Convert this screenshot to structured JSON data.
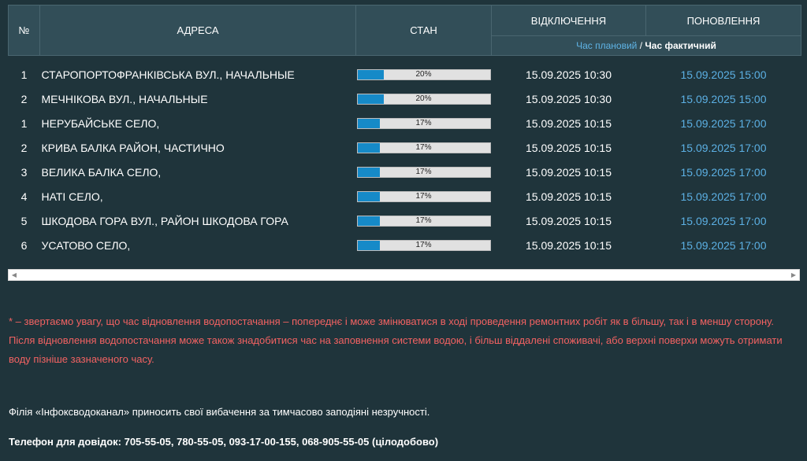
{
  "table": {
    "headers": {
      "num": "№",
      "address": "АДРЕСА",
      "status": "СТАН",
      "outage": "ВІДКЛЮЧЕННЯ",
      "restore": "ПОНОВЛЕННЯ",
      "sub_planned": "Час плановий",
      "sub_sep": " / ",
      "sub_actual": "Час фактичний"
    },
    "rows": [
      {
        "num": "1",
        "address": "СТАРОПОРТОФРАНКІВСЬКА ВУЛ., НАЧАЛЬНЫЕ",
        "progress": 0.2,
        "pct": "20%",
        "off": "15.09.2025 10:30",
        "on": "15.09.2025 15:00"
      },
      {
        "num": "2",
        "address": "МЕЧНІКОВА ВУЛ., НАЧАЛЬНЫЕ",
        "progress": 0.2,
        "pct": "20%",
        "off": "15.09.2025 10:30",
        "on": "15.09.2025 15:00"
      },
      {
        "num": "1",
        "address": "НЕРУБАЙСЬКЕ СЕЛО,",
        "progress": 0.17,
        "pct": "17%",
        "off": "15.09.2025 10:15",
        "on": "15.09.2025 17:00"
      },
      {
        "num": "2",
        "address": "КРИВА БАЛКА РАЙОН, ЧАСТИЧНО",
        "progress": 0.17,
        "pct": "17%",
        "off": "15.09.2025 10:15",
        "on": "15.09.2025 17:00"
      },
      {
        "num": "3",
        "address": "ВЕЛИКА БАЛКА СЕЛО,",
        "progress": 0.17,
        "pct": "17%",
        "off": "15.09.2025 10:15",
        "on": "15.09.2025 17:00"
      },
      {
        "num": "4",
        "address": "НАТІ СЕЛО,",
        "progress": 0.17,
        "pct": "17%",
        "off": "15.09.2025 10:15",
        "on": "15.09.2025 17:00"
      },
      {
        "num": "5",
        "address": "ШКОДОВА ГОРА ВУЛ., РАЙОН ШКОДОВА ГОРА",
        "progress": 0.17,
        "pct": "17%",
        "off": "15.09.2025 10:15",
        "on": "15.09.2025 17:00"
      },
      {
        "num": "6",
        "address": "УСАТОВО СЕЛО,",
        "progress": 0.17,
        "pct": "17%",
        "off": "15.09.2025 10:15",
        "on": "15.09.2025 17:00"
      }
    ]
  },
  "scrollbar": {
    "left_arrow": "◀",
    "right_arrow": "▶"
  },
  "note": "* – звертаємо увагу, що час відновлення водопостачання – попереднє і може змінюватися в ході проведення ремонтних робіт як в більшу, так і в меншу сторону. Після відновлення водопостачання може також знадобитися час на заповнення системи водою, і більш віддалені споживачі, або верхні поверхи можуть отримати воду пізніше зазначеного часу.",
  "thanks": "Філія «Інфоксводоканал» приносить свої вибачення за тимчасово заподіяні незручності.",
  "phones": "Телефон для довідок: 705-55-05, 780-55-05, 093-17-00-155, 068-905-55-05 (цілодобово)",
  "colors": {
    "background": "#1f343b",
    "header_bg": "#324e58",
    "progress_fill": "#168ac8",
    "restore_time": "#5cb0e4",
    "note_text": "#f26262"
  }
}
